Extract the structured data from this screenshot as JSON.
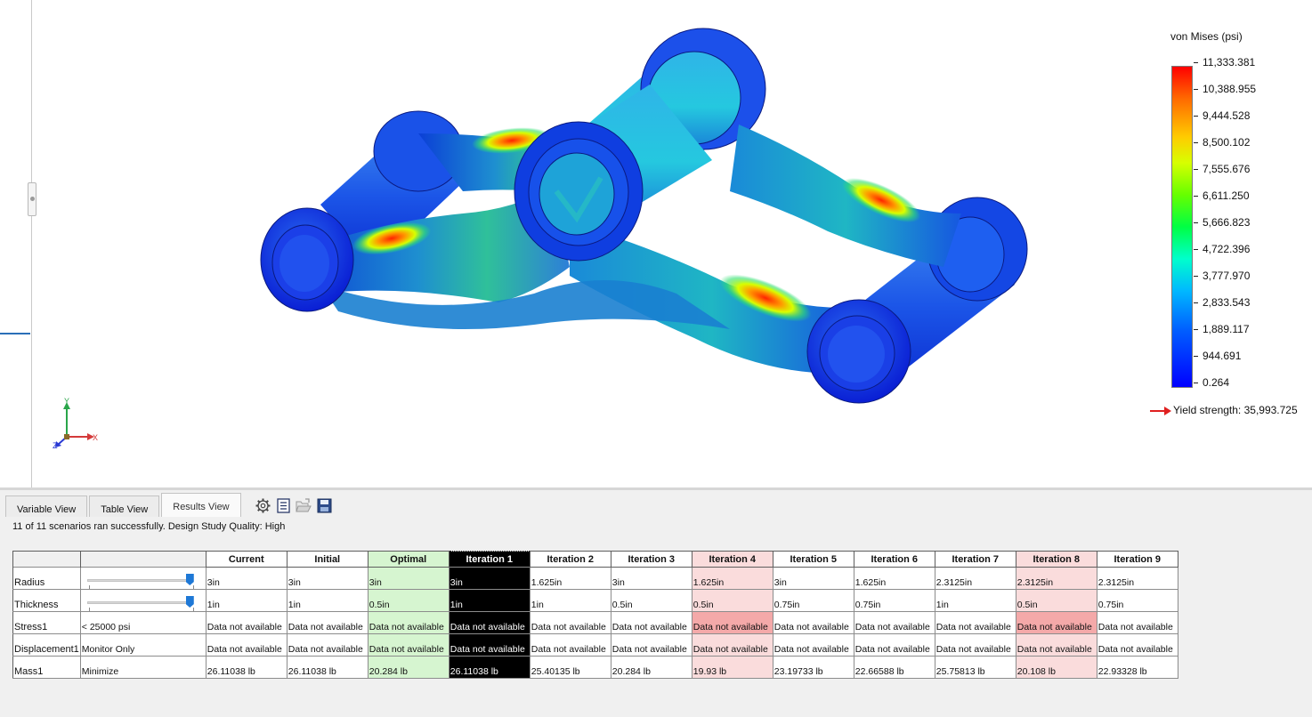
{
  "legend": {
    "title": "von Mises (psi)",
    "labels": [
      "11,333.381",
      "10,388.955",
      "9,444.528",
      "8,500.102",
      "7,555.676",
      "6,611.250",
      "5,666.823",
      "4,722.396",
      "3,777.970",
      "2,833.543",
      "1,889.117",
      "944.691",
      "0.264"
    ],
    "yield": "Yield strength: 35,993.725"
  },
  "triad": {
    "x": "X",
    "y": "Y",
    "z": "Z"
  },
  "tabs": [
    {
      "label": "Variable View"
    },
    {
      "label": "Table View"
    },
    {
      "label": "Results View"
    }
  ],
  "toolbar": [
    "settings-icon",
    "list-icon",
    "open-folder-icon",
    "save-icon"
  ],
  "status": "11 of 11 scenarios ran successfully. Design Study Quality: High",
  "results": {
    "columns": [
      "Current",
      "Initial",
      "Optimal",
      "Iteration 1",
      "Iteration 2",
      "Iteration 3",
      "Iteration 4",
      "Iteration 5",
      "Iteration 6",
      "Iteration 7",
      "Iteration 8",
      "Iteration 9"
    ],
    "rows": [
      {
        "label": "Radius",
        "condition": "",
        "slider": true,
        "values": [
          "3in",
          "3in",
          "3in",
          "3in",
          "1.625in",
          "3in",
          "1.625in",
          "3in",
          "1.625in",
          "2.3125in",
          "2.3125in",
          "2.3125in"
        ]
      },
      {
        "label": "Thickness",
        "condition": "",
        "slider": true,
        "values": [
          "1in",
          "1in",
          "0.5in",
          "1in",
          "1in",
          "0.5in",
          "0.5in",
          "0.75in",
          "0.75in",
          "1in",
          "0.5in",
          "0.75in"
        ]
      },
      {
        "label": "Stress1",
        "condition": "< 25000 psi",
        "slider": false,
        "values": [
          "Data not available",
          "Data not available",
          "Data not available",
          "Data not available",
          "Data not available",
          "Data not available",
          "Data not available",
          "Data not available",
          "Data not available",
          "Data not available",
          "Data not available",
          "Data not available"
        ]
      },
      {
        "label": "Displacement1",
        "condition": "Monitor Only",
        "slider": false,
        "values": [
          "Data not available",
          "Data not available",
          "Data not available",
          "Data not available",
          "Data not available",
          "Data not available",
          "Data not available",
          "Data not available",
          "Data not available",
          "Data not available",
          "Data not available",
          "Data not available"
        ]
      },
      {
        "label": "Mass1",
        "condition": "Minimize",
        "slider": false,
        "values": [
          "26.11038 lb",
          "26.11038 lb",
          "20.284 lb",
          "26.11038 lb",
          "25.40135 lb",
          "20.284 lb",
          "19.93 lb",
          "23.19733 lb",
          "22.66588 lb",
          "25.75813 lb",
          "20.108 lb",
          "22.93328 lb"
        ]
      }
    ],
    "optimal_column": 2,
    "selected_column": 3,
    "failed_columns": [
      6,
      10
    ],
    "colors": {
      "optimal": "#d6f5d0",
      "selected": "#000000",
      "failed": "#fadcdc",
      "failed_strong": "#f4a9a9"
    }
  }
}
